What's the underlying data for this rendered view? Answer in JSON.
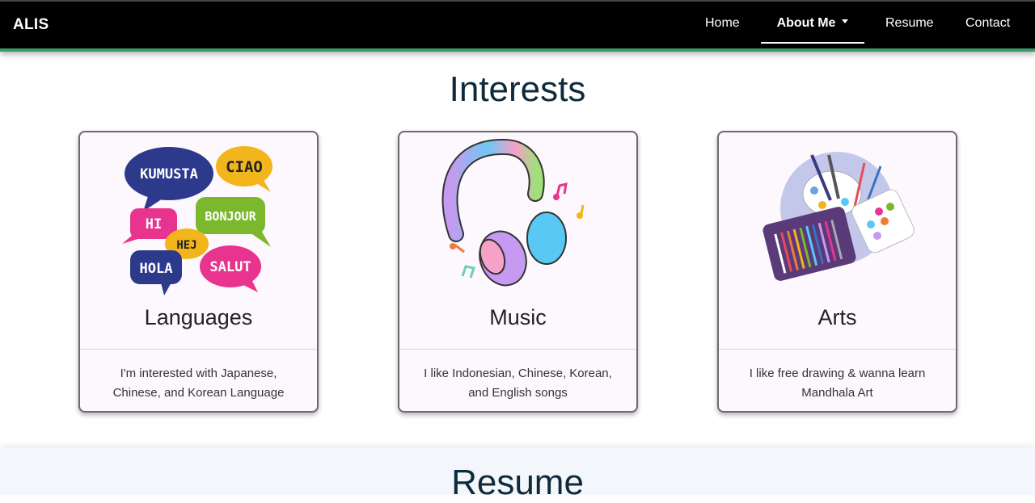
{
  "nav": {
    "brand": "ALIS",
    "items": [
      {
        "label": "Home"
      },
      {
        "label": "About Me"
      },
      {
        "label": "Resume"
      },
      {
        "label": "Contact"
      }
    ]
  },
  "interests": {
    "title": "Interests",
    "cards": [
      {
        "title": "Languages",
        "description": "I'm interested with Japanese, Chinese, and Korean Language",
        "image_words": [
          "KUMUSTA",
          "CIAO",
          "HI",
          "BONJOUR",
          "HEJ",
          "HOLA",
          "SALUT"
        ]
      },
      {
        "title": "Music",
        "description": "I like Indonesian, Chinese, Korean, and English songs"
      },
      {
        "title": "Arts",
        "description": "I like free drawing & wanna learn Mandhala Art"
      }
    ]
  },
  "resume": {
    "title": "Resume"
  },
  "colors": {
    "nav_bg": "#000000",
    "nav_accent": "#3a9a6a",
    "heading": "#0e2a3b",
    "card_bg": "#fdf8fd"
  }
}
